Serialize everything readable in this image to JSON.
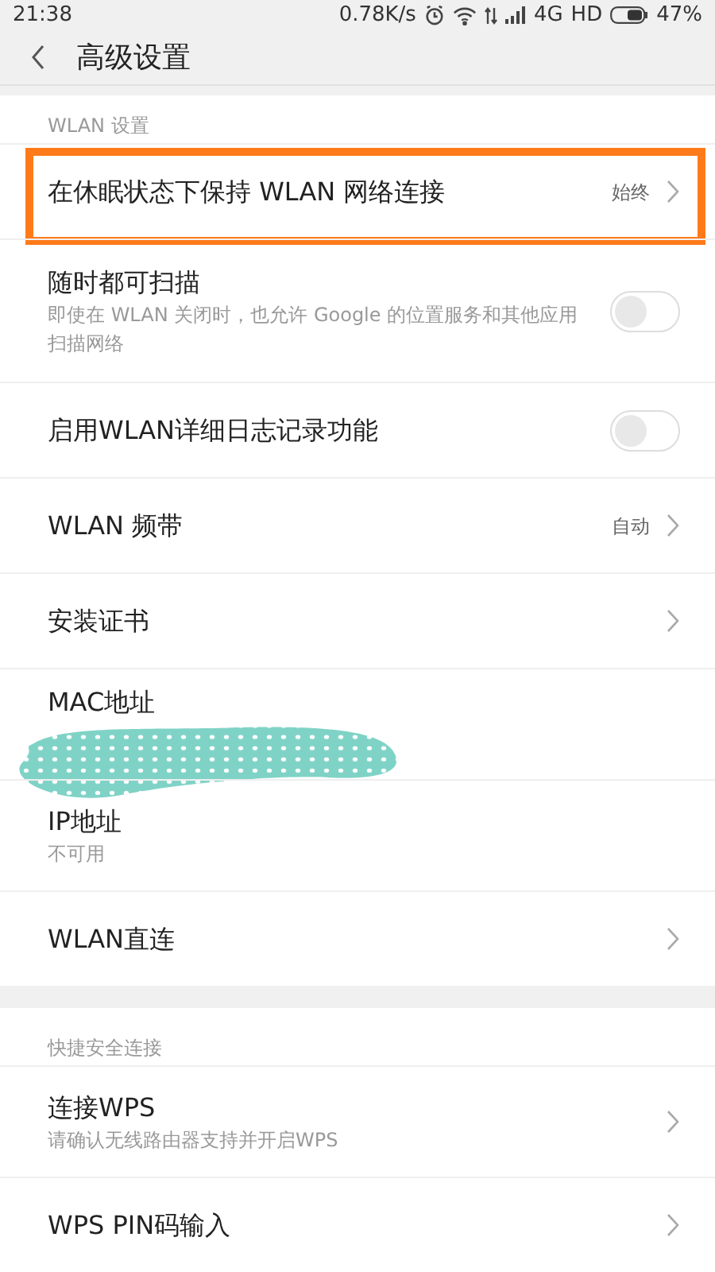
{
  "status_bar": {
    "time": "21:38",
    "speed": "0.78K/s",
    "network": "4G",
    "hd": "HD",
    "battery": "47%"
  },
  "header": {
    "title": "高级设置"
  },
  "sections": [
    {
      "title": "WLAN 设置",
      "items": [
        {
          "kind": "chevron",
          "title": "在休眠状态下保持 WLAN 网络连接",
          "value": "始终",
          "highlighted": true
        },
        {
          "kind": "toggle",
          "title": "随时都可扫描",
          "subtitle": "即使在 WLAN 关闭时，也允许 Google 的位置服务和其他应用扫描网络",
          "on": false
        },
        {
          "kind": "toggle",
          "title": "启用WLAN详细日志记录功能",
          "on": false
        },
        {
          "kind": "chevron",
          "title": "WLAN 频带",
          "value": "自动"
        },
        {
          "kind": "chevron",
          "title": "安装证书"
        },
        {
          "kind": "info",
          "title": "MAC地址",
          "redacted": true
        },
        {
          "kind": "info",
          "title": "IP地址",
          "subtitle": "不可用"
        },
        {
          "kind": "chevron",
          "title": "WLAN直连"
        }
      ]
    },
    {
      "title": "快捷安全连接",
      "items": [
        {
          "kind": "chevron",
          "title": "连接WPS",
          "subtitle": "请确认无线路由器支持并开启WPS"
        },
        {
          "kind": "chevron",
          "title": "WPS PIN码输入"
        }
      ]
    }
  ]
}
